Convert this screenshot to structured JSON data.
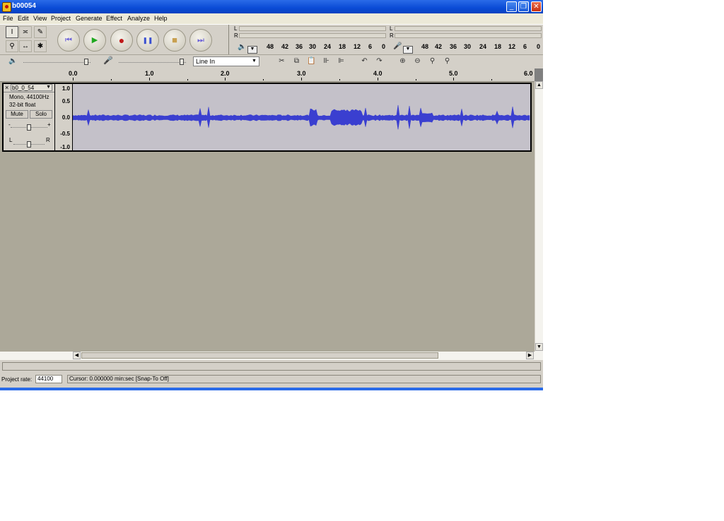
{
  "window": {
    "title": "b00054"
  },
  "menu": [
    "File",
    "Edit",
    "View",
    "Project",
    "Generate",
    "Effect",
    "Analyze",
    "Help"
  ],
  "tools": {
    "selection": "I",
    "envelope": "≍",
    "draw": "✎",
    "zoom": "⚲",
    "timeshift": "↔",
    "multi": "✱"
  },
  "transport": {
    "skip_start": "⏮",
    "play": "▶",
    "record": "●",
    "pause": "❚❚",
    "stop": "■",
    "skip_end": "⏭"
  },
  "meters": {
    "left": "L",
    "right": "R",
    "play_scale": [
      "48",
      "42",
      "36",
      "30",
      "24",
      "18",
      "12",
      "6",
      "0"
    ],
    "rec_scale": [
      "48",
      "42",
      "36",
      "30",
      "24",
      "18",
      "12",
      "6",
      "0"
    ]
  },
  "mixer": {
    "input_source": "Line In"
  },
  "ruler": {
    "labels": [
      "0.0",
      "1.0",
      "2.0",
      "3.0",
      "4.0",
      "5.0",
      "6.0"
    ]
  },
  "track": {
    "name": "b0_0_54",
    "format": "Mono, 44100Hz",
    "sample_format": "32-bit float",
    "mute_label": "Mute",
    "solo_label": "Solo",
    "pan_left": "L",
    "pan_right": "R",
    "gain_minus": "-",
    "gain_plus": "+",
    "close": "×",
    "scale": [
      "1.0",
      "0.5",
      "0.0",
      "-0.5",
      "-1.0"
    ]
  },
  "status": {
    "project_rate_label": "Project rate:",
    "project_rate_value": "44100",
    "cursor_text": "Cursor: 0.000000 min:sec   [Snap-To Off]"
  },
  "colors": {
    "waveform": "#3a3fd0",
    "titlebar": "#0a4bd6"
  }
}
